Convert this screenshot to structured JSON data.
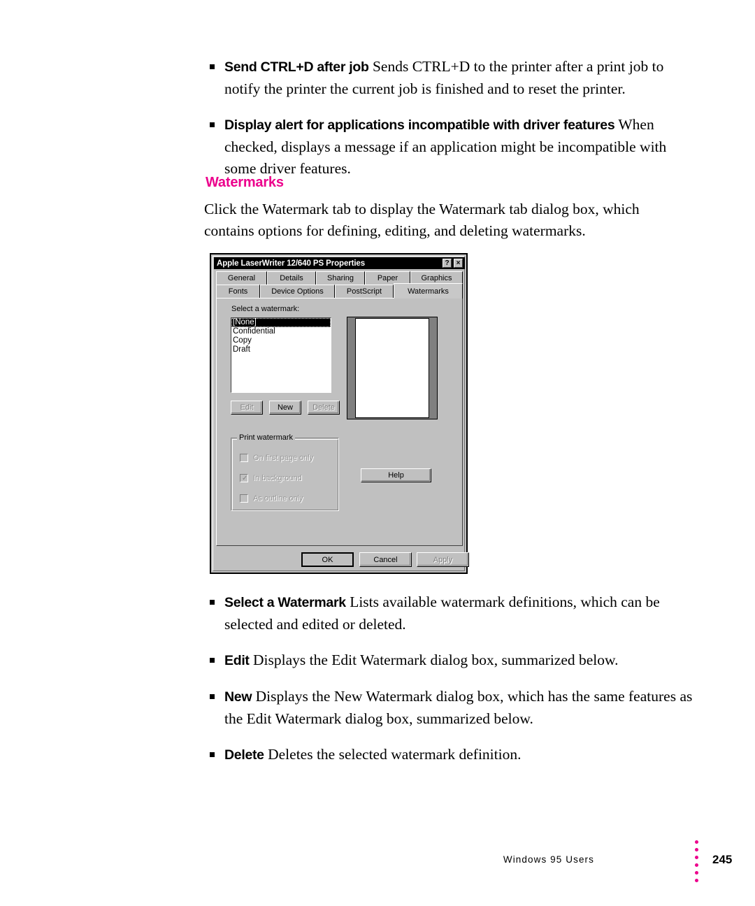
{
  "colors": {
    "accent_magenta": "#EC008C",
    "dialog_face": "#C0C0C0",
    "titlebar": "#000000",
    "disabled_text": "#808080"
  },
  "page": {
    "bullets_top": [
      {
        "term": "Send CTRL+D after job",
        "text": " Sends CTRL+D to the printer after a print job to notify the printer the current job is finished and to reset the printer."
      },
      {
        "term": "Display alert for applications incompatible with driver features",
        "text": "  When checked, displays a message if an application might be incompatible with some driver features."
      }
    ],
    "section_heading": "Watermarks",
    "intro_paragraph": "Click the Watermark tab to display the Watermark tab dialog box, which contains options for defining, editing, and deleting watermarks.",
    "bullets_bottom": [
      {
        "term": "Select a Watermark",
        "text": "  Lists available watermark definitions, which can be selected and edited or deleted."
      },
      {
        "term": "Edit",
        "text": "  Displays the Edit Watermark dialog box, summarized below."
      },
      {
        "term": "New",
        "text": "  Displays the New Watermark dialog box, which has the same features as the Edit Watermark dialog box, summarized below."
      },
      {
        "term": "Delete",
        "text": "  Deletes the selected watermark definition."
      }
    ]
  },
  "footer": {
    "label": "Windows 95 Users",
    "page_number": "245",
    "dot_count": 6,
    "dot_color": "#EC008C"
  },
  "dialog": {
    "title": "Apple LaserWriter 12/640 PS Properties",
    "titlebar_buttons": {
      "help": "?",
      "close": "×"
    },
    "tabs_row1": [
      {
        "label": "General",
        "active": false
      },
      {
        "label": "Details",
        "active": false
      },
      {
        "label": "Sharing",
        "active": false
      },
      {
        "label": "Paper",
        "active": false
      },
      {
        "label": "Graphics",
        "active": false
      }
    ],
    "tabs_row2": [
      {
        "label": "Fonts",
        "active": false
      },
      {
        "label": "Device Options",
        "active": false
      },
      {
        "label": "PostScript",
        "active": false
      },
      {
        "label": "Watermarks",
        "active": true
      }
    ],
    "select_label": "Select a watermark:",
    "watermark_list": [
      {
        "label": "[None]",
        "selected": true
      },
      {
        "label": "Confidential",
        "selected": false
      },
      {
        "label": "Copy",
        "selected": false
      },
      {
        "label": "Draft",
        "selected": false
      }
    ],
    "list_buttons": [
      {
        "label": "Edit",
        "enabled": false
      },
      {
        "label": "New",
        "enabled": true
      },
      {
        "label": "Delete",
        "enabled": false
      }
    ],
    "group": {
      "title": "Print watermark",
      "checkboxes": [
        {
          "label": "On first page only",
          "checked": false,
          "enabled": false
        },
        {
          "label": "In background",
          "checked": true,
          "enabled": false
        },
        {
          "label": "As outline only",
          "checked": false,
          "enabled": false
        }
      ]
    },
    "help_button": "Help",
    "action_buttons": [
      {
        "label": "OK",
        "enabled": true,
        "default": true
      },
      {
        "label": "Cancel",
        "enabled": true,
        "default": false
      },
      {
        "label": "Apply",
        "enabled": false,
        "default": false
      }
    ]
  }
}
